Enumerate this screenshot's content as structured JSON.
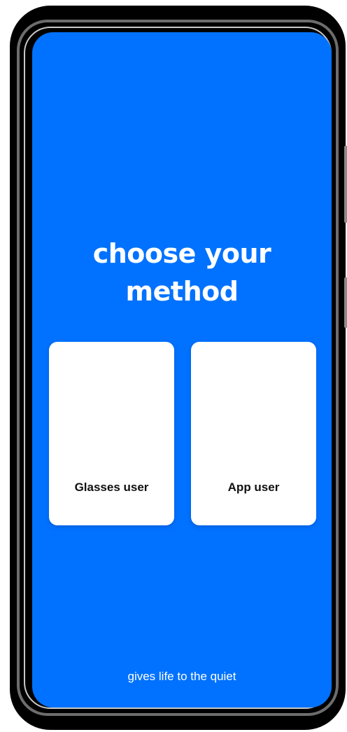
{
  "screen": {
    "title": "choose your method",
    "background_color": "#0072FF",
    "method_options": [
      {
        "label": "Glasses user"
      },
      {
        "label": "App user"
      }
    ],
    "tagline": "gives life to the quiet"
  },
  "device": {
    "frame_color": "#000000"
  }
}
